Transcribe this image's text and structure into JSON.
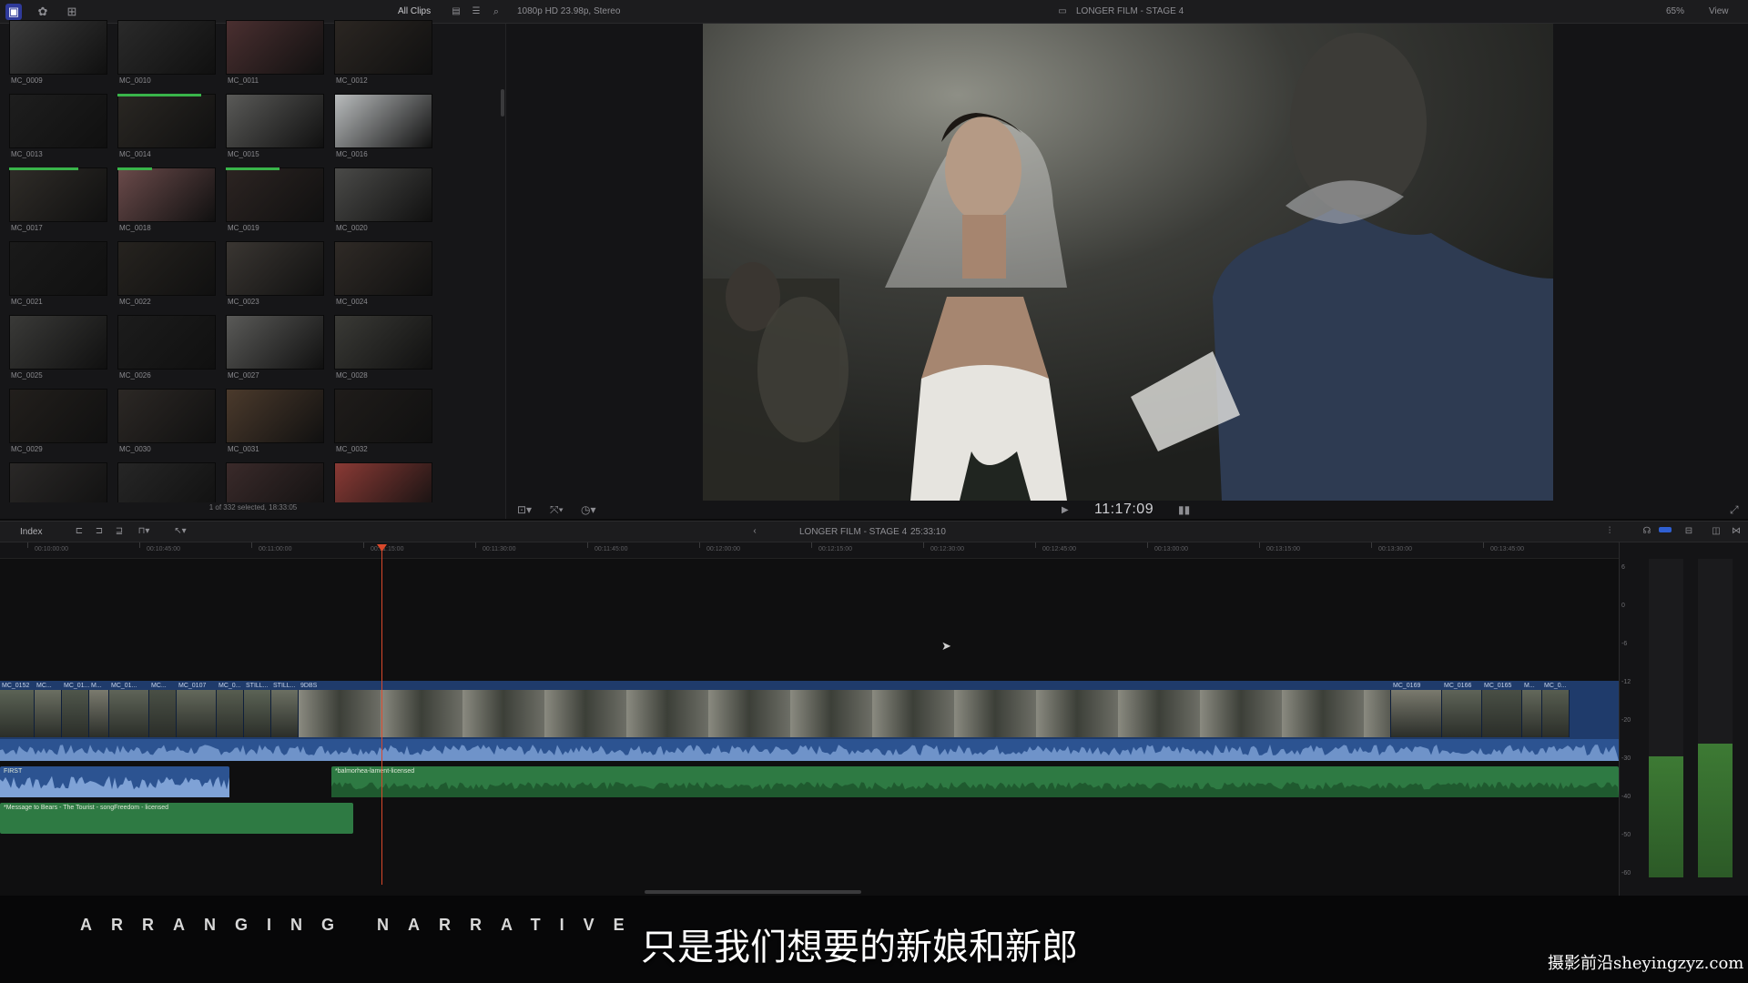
{
  "topbar": {
    "clip_filter": "All Clips",
    "format": "1080p HD 23.98p, Stereo",
    "project": "LONGER FILM - STAGE 4",
    "zoom": "65%",
    "view": "View"
  },
  "browser": {
    "clips": [
      {
        "name": "MC_0009",
        "bg": "#3a3a3a",
        "used": 0
      },
      {
        "name": "MC_0010",
        "bg": "#2a2a2a",
        "used": 0
      },
      {
        "name": "MC_0011",
        "bg": "#4a2f30",
        "used": 0
      },
      {
        "name": "MC_0012",
        "bg": "#2b2622",
        "used": 0
      },
      {
        "name": "MC_0013",
        "bg": "#1e1e1e",
        "used": 0
      },
      {
        "name": "MC_0014",
        "bg": "#2a2723",
        "used": 0.85
      },
      {
        "name": "MC_0015",
        "bg": "#5a5a58",
        "used": 0
      },
      {
        "name": "MC_0016",
        "bg": "#b9bcbd",
        "used": 0
      },
      {
        "name": "MC_0017",
        "bg": "#2f2c28",
        "used": 0.7
      },
      {
        "name": "MC_0018",
        "bg": "#6a4a4a",
        "used": 0.35
      },
      {
        "name": "MC_0019",
        "bg": "#2c2422",
        "used": 0.55
      },
      {
        "name": "MC_0020",
        "bg": "#4a4a48",
        "used": 0
      },
      {
        "name": "MC_0021",
        "bg": "#1a1a1a",
        "used": 0
      },
      {
        "name": "MC_0022",
        "bg": "#26231f",
        "used": 0
      },
      {
        "name": "MC_0023",
        "bg": "#3a3632",
        "used": 0
      },
      {
        "name": "MC_0024",
        "bg": "#2f2a26",
        "used": 0
      },
      {
        "name": "MC_0025",
        "bg": "#3a3a38",
        "used": 0
      },
      {
        "name": "MC_0026",
        "bg": "#1c1c1c",
        "used": 0
      },
      {
        "name": "MC_0027",
        "bg": "#5a5a58",
        "used": 0
      },
      {
        "name": "MC_0028",
        "bg": "#3a3a36",
        "used": 0
      },
      {
        "name": "MC_0029",
        "bg": "#221f1c",
        "used": 0
      },
      {
        "name": "MC_0030",
        "bg": "#2c2825",
        "used": 0
      },
      {
        "name": "MC_0031",
        "bg": "#4b3a2c",
        "used": 0
      },
      {
        "name": "MC_0032",
        "bg": "#1f1c1a",
        "used": 0
      },
      {
        "name": "",
        "bg": "#2a2827",
        "used": 0
      },
      {
        "name": "",
        "bg": "#262626",
        "used": 0
      },
      {
        "name": "",
        "bg": "#3a2a2a",
        "used": 0
      },
      {
        "name": "",
        "bg": "#8a3a35",
        "used": 0
      }
    ],
    "status": "1 of 332 selected, 18:33:05"
  },
  "viewer": {
    "timecode": "11:17:09"
  },
  "timeline": {
    "index_label": "Index",
    "project_name": "LONGER FILM - STAGE 4",
    "duration": "25:33:10",
    "ruler": [
      "00:10:00:00",
      "00:10:45:00",
      "00:11:00:00",
      "00:11:15:00",
      "00:11:30:00",
      "00:11:45:00",
      "00:12:00:00",
      "00:12:15:00",
      "00:12:30:00",
      "00:12:45:00",
      "00:13:00:00",
      "00:13:15:00",
      "00:13:30:00",
      "00:13:45:00"
    ],
    "video_clip_labels": [
      "MC_0152",
      "MC...",
      "MC_01...",
      "M...",
      "MC_01...",
      "MC...",
      "MC_0107",
      "MC_0...",
      "STILL...",
      "STILL...",
      "9DBS",
      "MC_0169",
      "MC_0166",
      "MC_0165",
      "M...",
      "MC_0..."
    ],
    "audio": {
      "music1": "FIRST",
      "music2": "*balmorhea-lament-licensed",
      "music3": "*Message to Bears - The Tourist - songFreedom - licensed"
    },
    "meter_scale": [
      "6",
      "0",
      "-6",
      "-12",
      "-20",
      "-30",
      "-40",
      "-50",
      "-60"
    ],
    "meter_levels": [
      0.38,
      0.42
    ]
  },
  "overlay": {
    "title": "ARRANGING NARRATIVE",
    "subtitle": "只是我们想要的新娘和新郎",
    "watermark": "摄影前沿sheyingzyz.com"
  }
}
